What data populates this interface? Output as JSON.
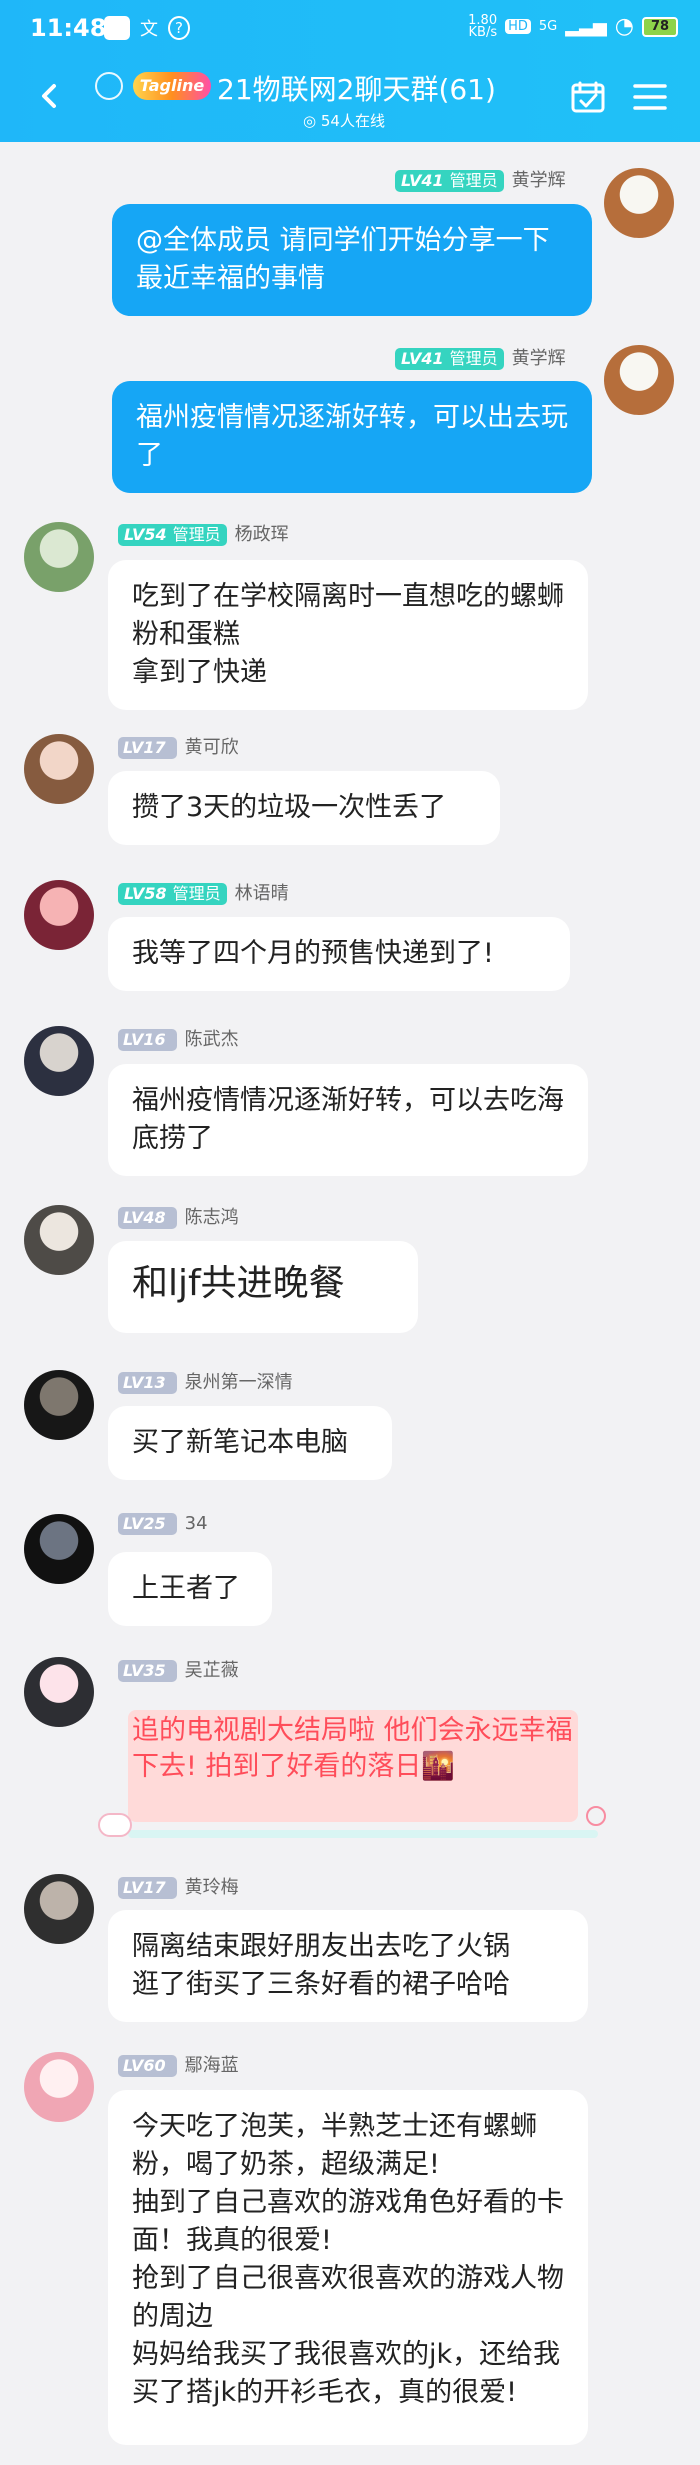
{
  "status_bar": {
    "time": "11:48",
    "network_speed": "1.80\nKB/s",
    "hd": "HD",
    "signal": "5G",
    "battery": "78"
  },
  "header": {
    "title": "21物联网2聊天群(61)",
    "brand": "Tagline",
    "online": "54人在线"
  },
  "messages": [
    {
      "level": "LV41",
      "role": "管理员",
      "name": "黄学辉",
      "text": "@全体成员 请同学们开始分享一下最近幸福的事情",
      "self": true
    },
    {
      "level": "LV41",
      "role": "管理员",
      "name": "黄学辉",
      "text": "福州疫情情况逐渐好转，可以出去玩了",
      "self": true
    },
    {
      "level": "LV54",
      "role": "管理员",
      "name": "杨政珲",
      "text": "吃到了在学校隔离时一直想吃的螺蛳粉和蛋糕\n拿到了快递",
      "self": false
    },
    {
      "level": "LV17",
      "role": "",
      "name": "黄可欣",
      "text": "攒了3天的垃圾一次性丢了",
      "self": false
    },
    {
      "level": "LV58",
      "role": "管理员",
      "name": "林语晴",
      "text": "我等了四个月的预售快递到了!",
      "self": false
    },
    {
      "level": "LV16",
      "role": "",
      "name": "陈武杰",
      "text": "福州疫情情况逐渐好转，可以去吃海底捞了",
      "self": false
    },
    {
      "level": "LV48",
      "role": "",
      "name": "陈志鸿",
      "text": "和ljf共进晚餐",
      "self": false
    },
    {
      "level": "LV13",
      "role": "",
      "name": "泉州第一深情",
      "text": "买了新笔记本电脑",
      "self": false
    },
    {
      "level": "LV25",
      "role": "",
      "name": "34",
      "text": "上王者了",
      "self": false
    },
    {
      "level": "LV35",
      "role": "",
      "name": "吴芷薇",
      "text": "追的电视剧大结局啦 他们会永远幸福下去!\n拍到了好看的落日🌇",
      "self": false
    },
    {
      "level": "LV17",
      "role": "",
      "name": "黄玲梅",
      "text": "隔离结束跟好朋友出去吃了火锅\n逛了街买了三条好看的裙子哈哈",
      "self": false
    },
    {
      "level": "LV60",
      "role": "",
      "name": "鄢海蓝",
      "text": "今天吃了泡芙，半熟芝士还有螺蛳粉，喝了奶茶，超级满足!\n抽到了自己喜欢的游戏角色好看的卡面！我真的很爱!\n抢到了自己很喜欢很喜欢的游戏人物的周边\n妈妈给我买了我很喜欢的jk，还给我买了搭jk的开衫毛衣，真的很爱!",
      "self": false
    }
  ]
}
